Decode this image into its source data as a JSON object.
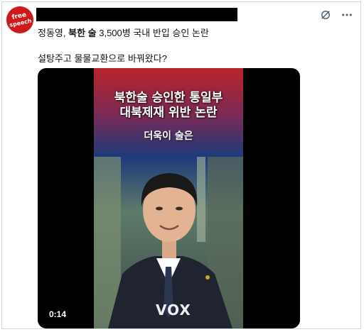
{
  "post": {
    "avatar_text_line1": "free",
    "avatar_text_line2": "speech",
    "subtitle_prefix": "정동영, ",
    "subtitle_bold": "북한 술",
    "subtitle_rest": " 3,500병 국내 반입 승인 논란",
    "body": "설탕주고 물물교환으로 바꿔왔다?"
  },
  "icons": {
    "grok": "grok-icon",
    "more": "more-options-icon"
  },
  "video": {
    "headline_line1": "북한술 승인한 통일부",
    "headline_line2": "대북제재 위반 논란",
    "caption": "더욱이 술은",
    "timestamp": "0:14",
    "logo": "VOX"
  },
  "colors": {
    "avatar_red": "#d01919",
    "border": "#cfd9de",
    "video_bg": "#000000",
    "frame_blue": "#1e3a7a",
    "frame_red": "#b8242b"
  }
}
